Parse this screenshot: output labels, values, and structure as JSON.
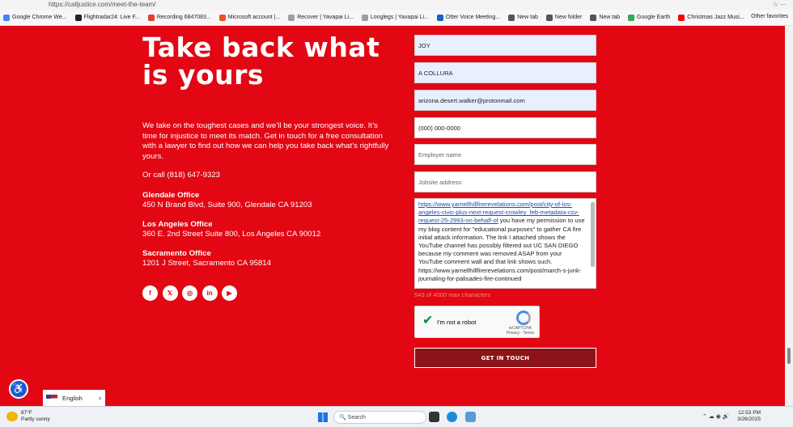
{
  "browser": {
    "url": "https://calljustice.com/meet-the-team/",
    "bookmarks": [
      {
        "label": "Google Chrome We...",
        "color": "#4285f4"
      },
      {
        "label": "Flightradar24: Live F...",
        "color": "#222222"
      },
      {
        "label": "Recording 6847083...",
        "color": "#e53935"
      },
      {
        "label": "Microsoft account |...",
        "color": "#f25022"
      },
      {
        "label": "Recover | Yavapai Li...",
        "color": "#9e9e9e"
      },
      {
        "label": "Longlegs | Yavapai Li...",
        "color": "#9e9e9e"
      },
      {
        "label": "Otter Voice Meeting...",
        "color": "#1565c0"
      },
      {
        "label": "New tab",
        "color": "#555555"
      },
      {
        "label": "New folder",
        "color": "#555555"
      },
      {
        "label": "New tab",
        "color": "#555555"
      },
      {
        "label": "Google Earth",
        "color": "#34a853"
      },
      {
        "label": "Christmas Jazz Musi...",
        "color": "#ff0000"
      }
    ],
    "other_favorites": "Other favorites"
  },
  "hero": {
    "headline": "Take back what is yours",
    "intro": "We take on the toughest cases and we’ll be your strongest voice. It’s time for injustice to meet its match. Get in touch for a free consultation with a lawyer to find out how we can help you take back what’s rightfully yours.",
    "call": "Or call (818) 647-9323"
  },
  "offices": [
    {
      "title": "Glendale Office",
      "address": "450 N Brand Blvd, Suite 900, Glendale CA 91203"
    },
    {
      "title": "Los Angeles Office",
      "address": "360 E. 2nd Street Suite 800, Los Angeles CA 90012"
    },
    {
      "title": "Sacramento Office",
      "address": "1201 J Street, Sacramento CA 95814"
    }
  ],
  "socials": [
    {
      "icon": "facebook-icon",
      "glyph": "f"
    },
    {
      "icon": "x-icon",
      "glyph": "𝕏"
    },
    {
      "icon": "instagram-icon",
      "glyph": "◎"
    },
    {
      "icon": "linkedin-icon",
      "glyph": "in"
    },
    {
      "icon": "youtube-icon",
      "glyph": "▶"
    }
  ],
  "form": {
    "first_name": "JOY",
    "last_name": "A COLLURA",
    "email": "arizona.desert.walker@protonmail.com",
    "phone_placeholder": "(000) 000-0000",
    "employer_placeholder": "Employer name",
    "jobsite_placeholder": "Jobsite address",
    "message_link": "https://www.yarnellhillfirerevelations.com/post/city-of-los-angeles-civic-plus-next-request-crowley_feb-metadata-csv-request-25-2993-on-behalf-of",
    "message_text": " you have my permission to use my blog content for \"educational purposes\" to gather CA fire initial attack information. The link I attached shows the YouTube channel has possibly filtered out UC SAN DIEGO because my comment was removed ASAP from your YouTube comment wall and that link shows such. https://www.yarnellhillfirerevelations.com/post/march-s-junk-journaling-for-palisades-fire-continued",
    "counter": "543 of 4000 max characters",
    "captcha_label": "I'm not a robot",
    "captcha_brand": "reCAPTCHA",
    "captcha_links": "Privacy - Terms",
    "submit_label": "GET IN TOUCH"
  },
  "language": {
    "label": "English"
  },
  "taskbar": {
    "temperature": "87°F",
    "weather": "Partly sunny",
    "search_placeholder": "Search",
    "time": "12:53 PM",
    "date": "3/26/2025"
  }
}
